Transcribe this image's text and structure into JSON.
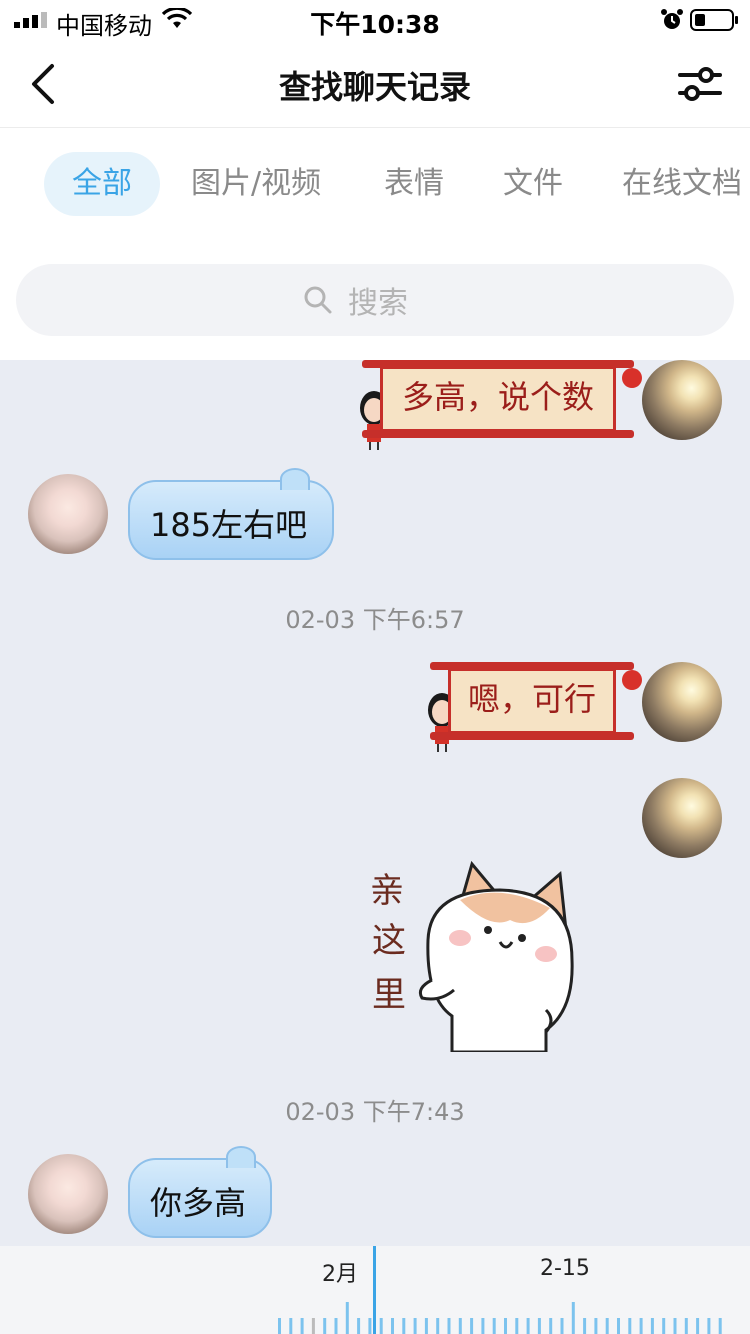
{
  "status_bar": {
    "carrier": "中国移动",
    "time": "下午10:38"
  },
  "nav": {
    "title": "查找聊天记录"
  },
  "tabs": [
    {
      "label": "全部",
      "active": true
    },
    {
      "label": "图片/视频",
      "active": false
    },
    {
      "label": "表情",
      "active": false
    },
    {
      "label": "文件",
      "active": false
    },
    {
      "label": "在线文档",
      "active": false
    }
  ],
  "search": {
    "placeholder": "搜索"
  },
  "messages": [
    {
      "side": "right",
      "kind": "scroll",
      "text": "多高，说个数"
    },
    {
      "side": "left",
      "kind": "bubble",
      "text": "185左右吧"
    },
    {
      "kind": "timestamp",
      "text": "02-03 下午6:57"
    },
    {
      "side": "right",
      "kind": "scroll",
      "text": "嗯，可行"
    },
    {
      "side": "right",
      "kind": "sticker",
      "text": "亲这里",
      "chars": [
        "亲",
        "这",
        "里"
      ]
    },
    {
      "kind": "timestamp",
      "text": "02-03 下午7:43"
    },
    {
      "side": "left",
      "kind": "bubble",
      "text": "你多高"
    }
  ],
  "timeline": {
    "labels": [
      "2月",
      "2-15"
    ]
  },
  "colors": {
    "accent": "#3aa4e6",
    "scroll_red": "#c62f2a",
    "bubble_blue": "#a9d2f5"
  }
}
